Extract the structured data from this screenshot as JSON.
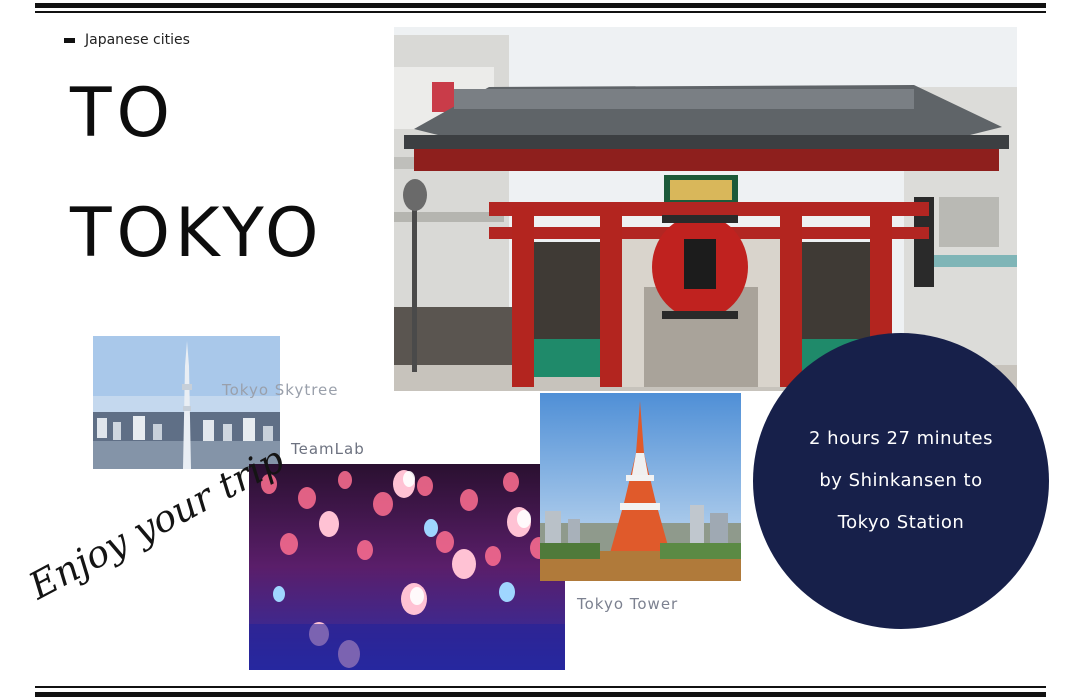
{
  "header": {
    "category": "Japanese cities",
    "headline_line1": "TO",
    "headline_line2": "TOKYO"
  },
  "photos": [
    {
      "name": "Kaminarimon gate"
    },
    {
      "name": "Tokyo Skytree",
      "caption": "Tokyo Skytree"
    },
    {
      "name": "TeamLab",
      "caption": "TeamLab"
    },
    {
      "name": "Tokyo Tower",
      "caption": "Tokyo Tower"
    }
  ],
  "info": {
    "line1": "2 hours 27 minutes",
    "line2": "by Shinkansen to",
    "line3": "Tokyo Station"
  },
  "tagline": "Enjoy your trip",
  "colors": {
    "circle": "#17204a",
    "text": "#111111",
    "caption": "#7c8190"
  }
}
